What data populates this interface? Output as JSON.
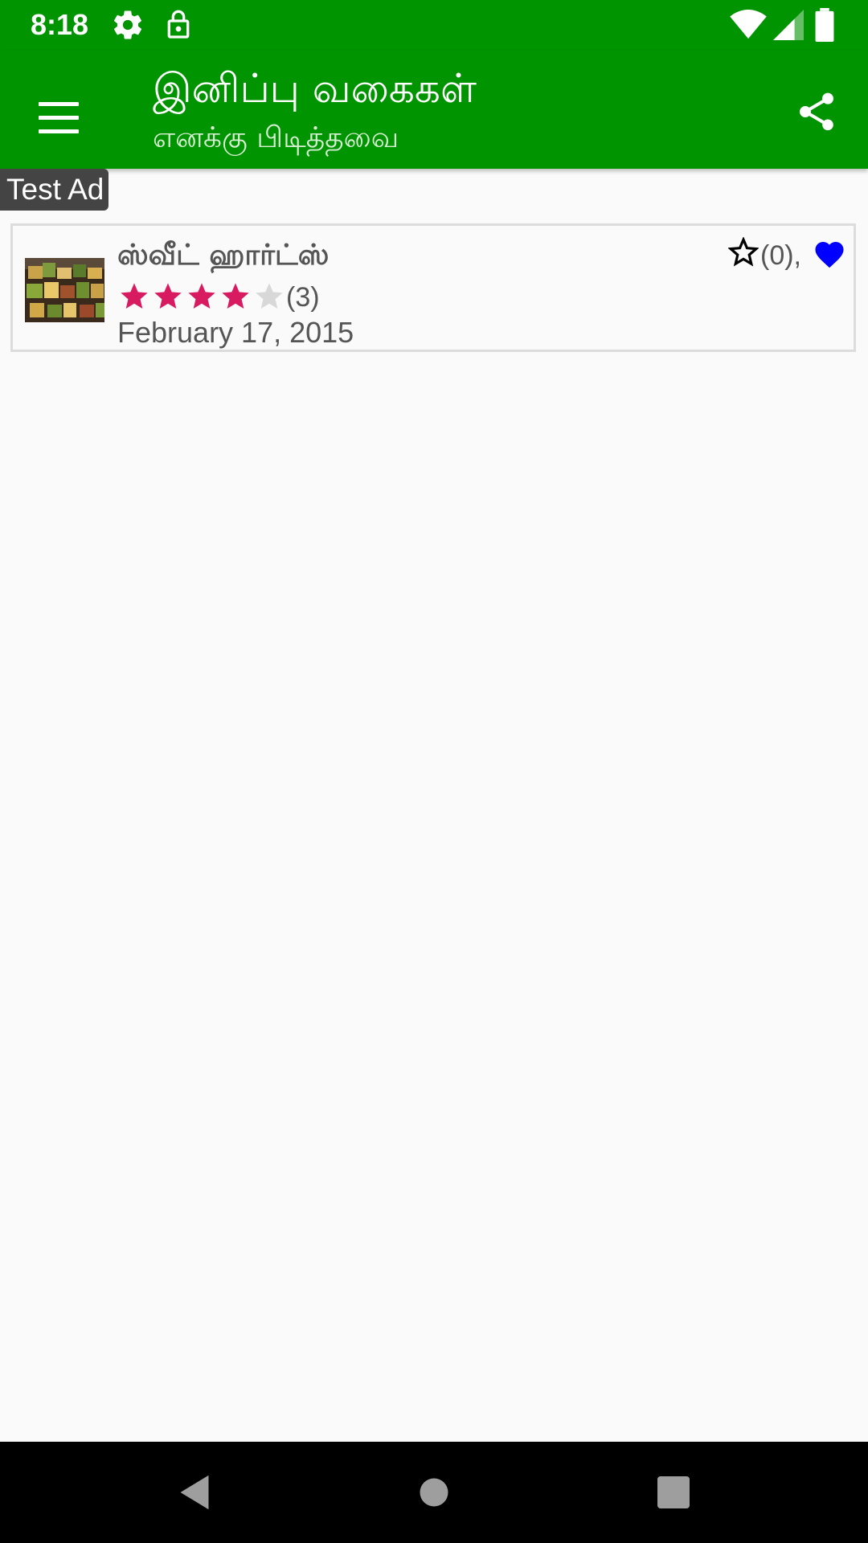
{
  "status_bar": {
    "time": "8:18",
    "icons": [
      "settings-icon",
      "lock-icon",
      "wifi-icon",
      "signal-icon",
      "battery-icon"
    ]
  },
  "app_bar": {
    "title": "இனிப்பு வகைகள்",
    "subtitle": "எனக்கு பிடித்தவை",
    "left_icon": "menu-icon",
    "right_icon": "share-icon"
  },
  "ad": {
    "label": "Test Ad"
  },
  "list": {
    "items": [
      {
        "title": "ஸ்வீட் ஹார்ட்ஸ்",
        "rating": 4,
        "rating_max": 5,
        "rating_count": "(3)",
        "date": "February 17, 2015",
        "favorites_count": "(0),",
        "favorite_icon": "heart-icon"
      }
    ]
  },
  "colors": {
    "primary": "#009400",
    "star_filled": "#d81b60",
    "star_empty": "#d8d8d8",
    "heart": "#0000ff"
  },
  "nav_bar": {
    "icons": [
      "back-icon",
      "home-icon",
      "recents-icon"
    ]
  }
}
